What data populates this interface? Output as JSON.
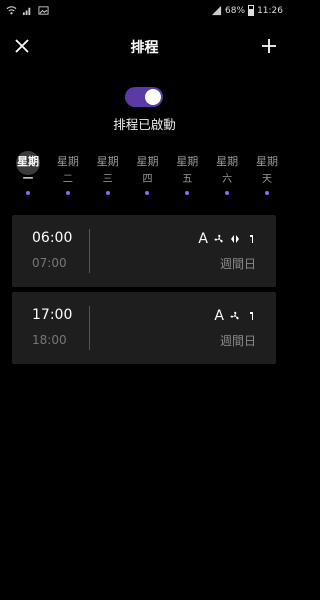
{
  "status_bar": {
    "battery": "68%",
    "time": "11:26"
  },
  "header": {
    "title": "排程"
  },
  "schedule_toggle": {
    "label": "排程已啟動",
    "enabled": true
  },
  "days": [
    {
      "line1": "星期",
      "line2": "一",
      "active": true
    },
    {
      "line1": "星期",
      "line2": "二",
      "active": false
    },
    {
      "line1": "星期",
      "line2": "三",
      "active": false
    },
    {
      "line1": "星期",
      "line2": "四",
      "active": false
    },
    {
      "line1": "星期",
      "line2": "五",
      "active": false
    },
    {
      "line1": "星期",
      "line2": "六",
      "active": false
    },
    {
      "line1": "星期",
      "line2": "天",
      "active": false
    }
  ],
  "schedules": [
    {
      "start": "06:00",
      "end": "07:00",
      "mode": "A",
      "icons": [
        "fan-icon",
        "swing-icon",
        "timer-icon"
      ],
      "days": "週間日"
    },
    {
      "start": "17:00",
      "end": "18:00",
      "mode": "A",
      "icons": [
        "fan-icon",
        "timer-icon"
      ],
      "days": "週間日"
    }
  ],
  "colors": {
    "accent": "#5b3aa6",
    "dot": "#8b6cf0",
    "card": "#1e1e1e",
    "background": "#000000"
  }
}
